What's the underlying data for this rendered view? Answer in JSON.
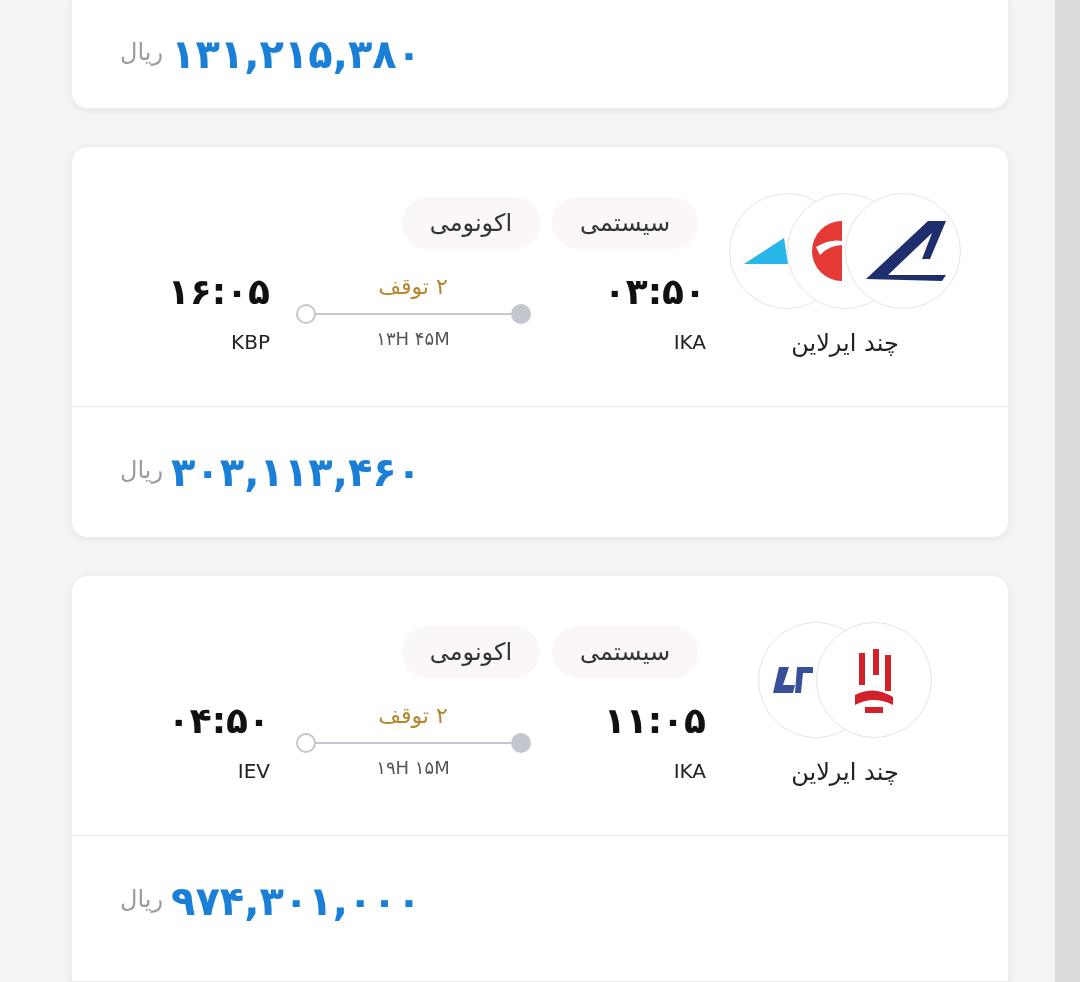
{
  "results": [
    {
      "price": "۱۳۱,۲۱۵,۳۸۰",
      "currency": "ریال"
    },
    {
      "logos": [
        {
          "kind": "navy-tail"
        },
        {
          "kind": "red-ball"
        },
        {
          "kind": "cyan-wing"
        }
      ],
      "tags": [
        "سیستمی",
        "اکونومی"
      ],
      "depart_time": "۰۳:۵۰",
      "depart_airport": "IKA",
      "stops": "۲ توقف",
      "duration": "۱۳H ۴۵M",
      "arrive_time": "۱۶:۰۵",
      "arrive_airport": "KBP",
      "airline_label": "چند ایرلاین",
      "price": "۳۰۳,۱۱۳,۴۶۰",
      "currency": "ریال"
    },
    {
      "logos": [
        {
          "kind": "red-calligraphy"
        },
        {
          "kind": "blue-letters"
        }
      ],
      "tags": [
        "سیستمی",
        "اکونومی"
      ],
      "depart_time": "۱۱:۰۵",
      "depart_airport": "IKA",
      "stops": "۲ توقف",
      "duration": "۱۹H ۱۵M",
      "arrive_time": "۰۴:۵۰",
      "arrive_airport": "IEV",
      "airline_label": "چند ایرلاین",
      "price": "۹۷۴,۳۰۱,۰۰۰",
      "currency": "ریال"
    }
  ]
}
